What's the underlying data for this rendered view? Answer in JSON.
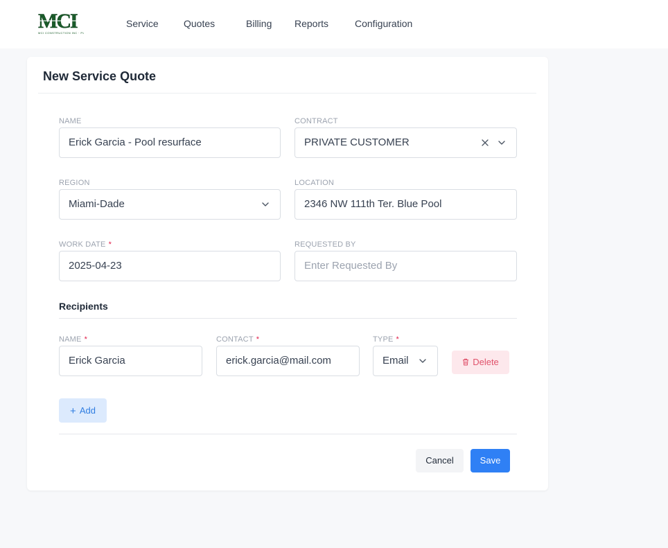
{
  "logo": {
    "text": "MCI",
    "subtitle": "MCI CONSTRUCTION INC · PLUMBING & MECHANICAL"
  },
  "nav": [
    "Service",
    "Quotes",
    "Billing",
    "Reports",
    "Configuration"
  ],
  "form": {
    "title": "New Service Quote",
    "name": {
      "label": "NAME",
      "value": "Erick Garcia - Pool resurface"
    },
    "contract": {
      "label": "CONTRACT",
      "value": "PRIVATE CUSTOMER"
    },
    "region": {
      "label": "REGION",
      "value": "Miami-Dade"
    },
    "location": {
      "label": "LOCATION",
      "value": "2346 NW 111th Ter. Blue Pool"
    },
    "work_date": {
      "label": "WORK DATE",
      "value": "2025-04-23",
      "required_mark": "*"
    },
    "requested_by": {
      "label": "REQUESTED BY",
      "value": "",
      "placeholder": "Enter Requested By"
    }
  },
  "recipients": {
    "title": "Recipients",
    "columns": {
      "name": {
        "label": "NAME",
        "required_mark": "*"
      },
      "contact": {
        "label": "CONTACT",
        "required_mark": "*"
      },
      "type": {
        "label": "TYPE",
        "required_mark": "*"
      }
    },
    "rows": [
      {
        "name": "Erick Garcia",
        "contact": "erick.garcia@mail.com",
        "type": "Email",
        "delete_label": "Delete"
      }
    ],
    "add_label": "Add"
  },
  "actions": {
    "cancel": "Cancel",
    "save": "Save"
  },
  "colors": {
    "primary": "#2f80f5",
    "danger": "#e0526b",
    "danger_bg": "#fde8ec",
    "add_bg": "#dceafd",
    "logo_green": "#1a5c2a"
  }
}
